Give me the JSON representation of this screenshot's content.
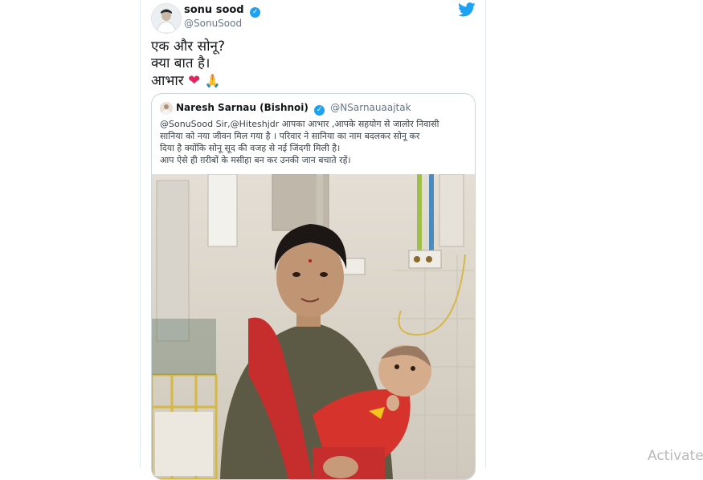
{
  "tweet": {
    "display_name": "sonu sood",
    "handle": "@SonuSood",
    "text_lines": [
      "एक और सोनू?",
      "क्या बात है।",
      "आभार"
    ],
    "emoji": [
      "heart-emoji",
      "folded-hands-emoji"
    ]
  },
  "quoted_tweet": {
    "display_name": "Naresh Sarnau (Bishnoi)",
    "handle": "@NSarnauaajtak",
    "text_lines": [
      "@SonuSood Sir,@Hiteshjdr आपका आभार ,आपके सहयोग से जालोर निवासी",
      "सानिया को नया जीवन मिल गया है । परिवार ने सानिया का नाम बदलकर सोनू कर",
      "दिया है क्योंकि सोनू सूद की वजह से नई जिंदगी मिली है।",
      "आप ऐसे ही ग़रीबों के मसीहा बन कर उनकी जान बचाते रहें।"
    ]
  },
  "overlay": {
    "watermark": "Activate"
  },
  "colors": {
    "twitter_blue": "#1da1f2",
    "text": "#14171a",
    "muted": "#657786",
    "heart": "#e0245e"
  },
  "icons": [
    "twitter-bird-icon",
    "verified-badge-icon"
  ]
}
